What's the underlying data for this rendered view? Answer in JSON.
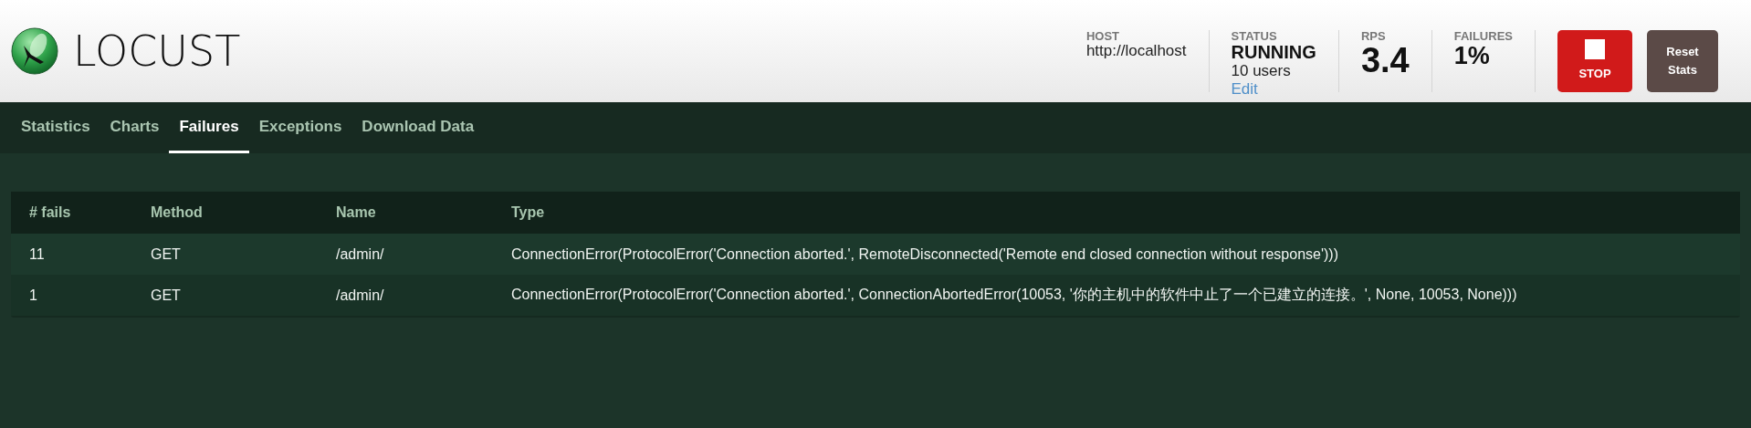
{
  "logo": {
    "text": "LOCUST"
  },
  "header_stats": [
    {
      "kind": "host",
      "label": "HOST",
      "value": "http://localhost"
    },
    {
      "kind": "status",
      "label": "STATUS",
      "value": "RUNNING",
      "detail": "10 users",
      "link": "Edit"
    },
    {
      "kind": "big",
      "label": "RPS",
      "value": "3.4"
    },
    {
      "kind": "medium",
      "label": "FAILURES",
      "value": "1%"
    }
  ],
  "buttons": [
    {
      "kind": "stop",
      "label": "STOP"
    },
    {
      "kind": "reset",
      "label": "Reset Stats"
    }
  ],
  "tabs": [
    {
      "label": "Statistics",
      "selected": false
    },
    {
      "label": "Charts",
      "selected": false
    },
    {
      "label": "Failures",
      "selected": true
    },
    {
      "label": "Exceptions",
      "selected": false
    },
    {
      "label": "Download Data",
      "selected": false
    }
  ],
  "table": {
    "columns": [
      "# fails",
      "Method",
      "Name",
      "Type"
    ],
    "rows": [
      [
        "11",
        "GET",
        "/admin/",
        "ConnectionError(ProtocolError('Connection aborted.', RemoteDisconnected('Remote end closed connection without response')))"
      ],
      [
        "1",
        "GET",
        "/admin/",
        "ConnectionError(ProtocolError('Connection aborted.', ConnectionAbortedError(10053, '你的主机中的软件中止了一个已建立的连接。', None, 10053, None)))"
      ]
    ]
  }
}
